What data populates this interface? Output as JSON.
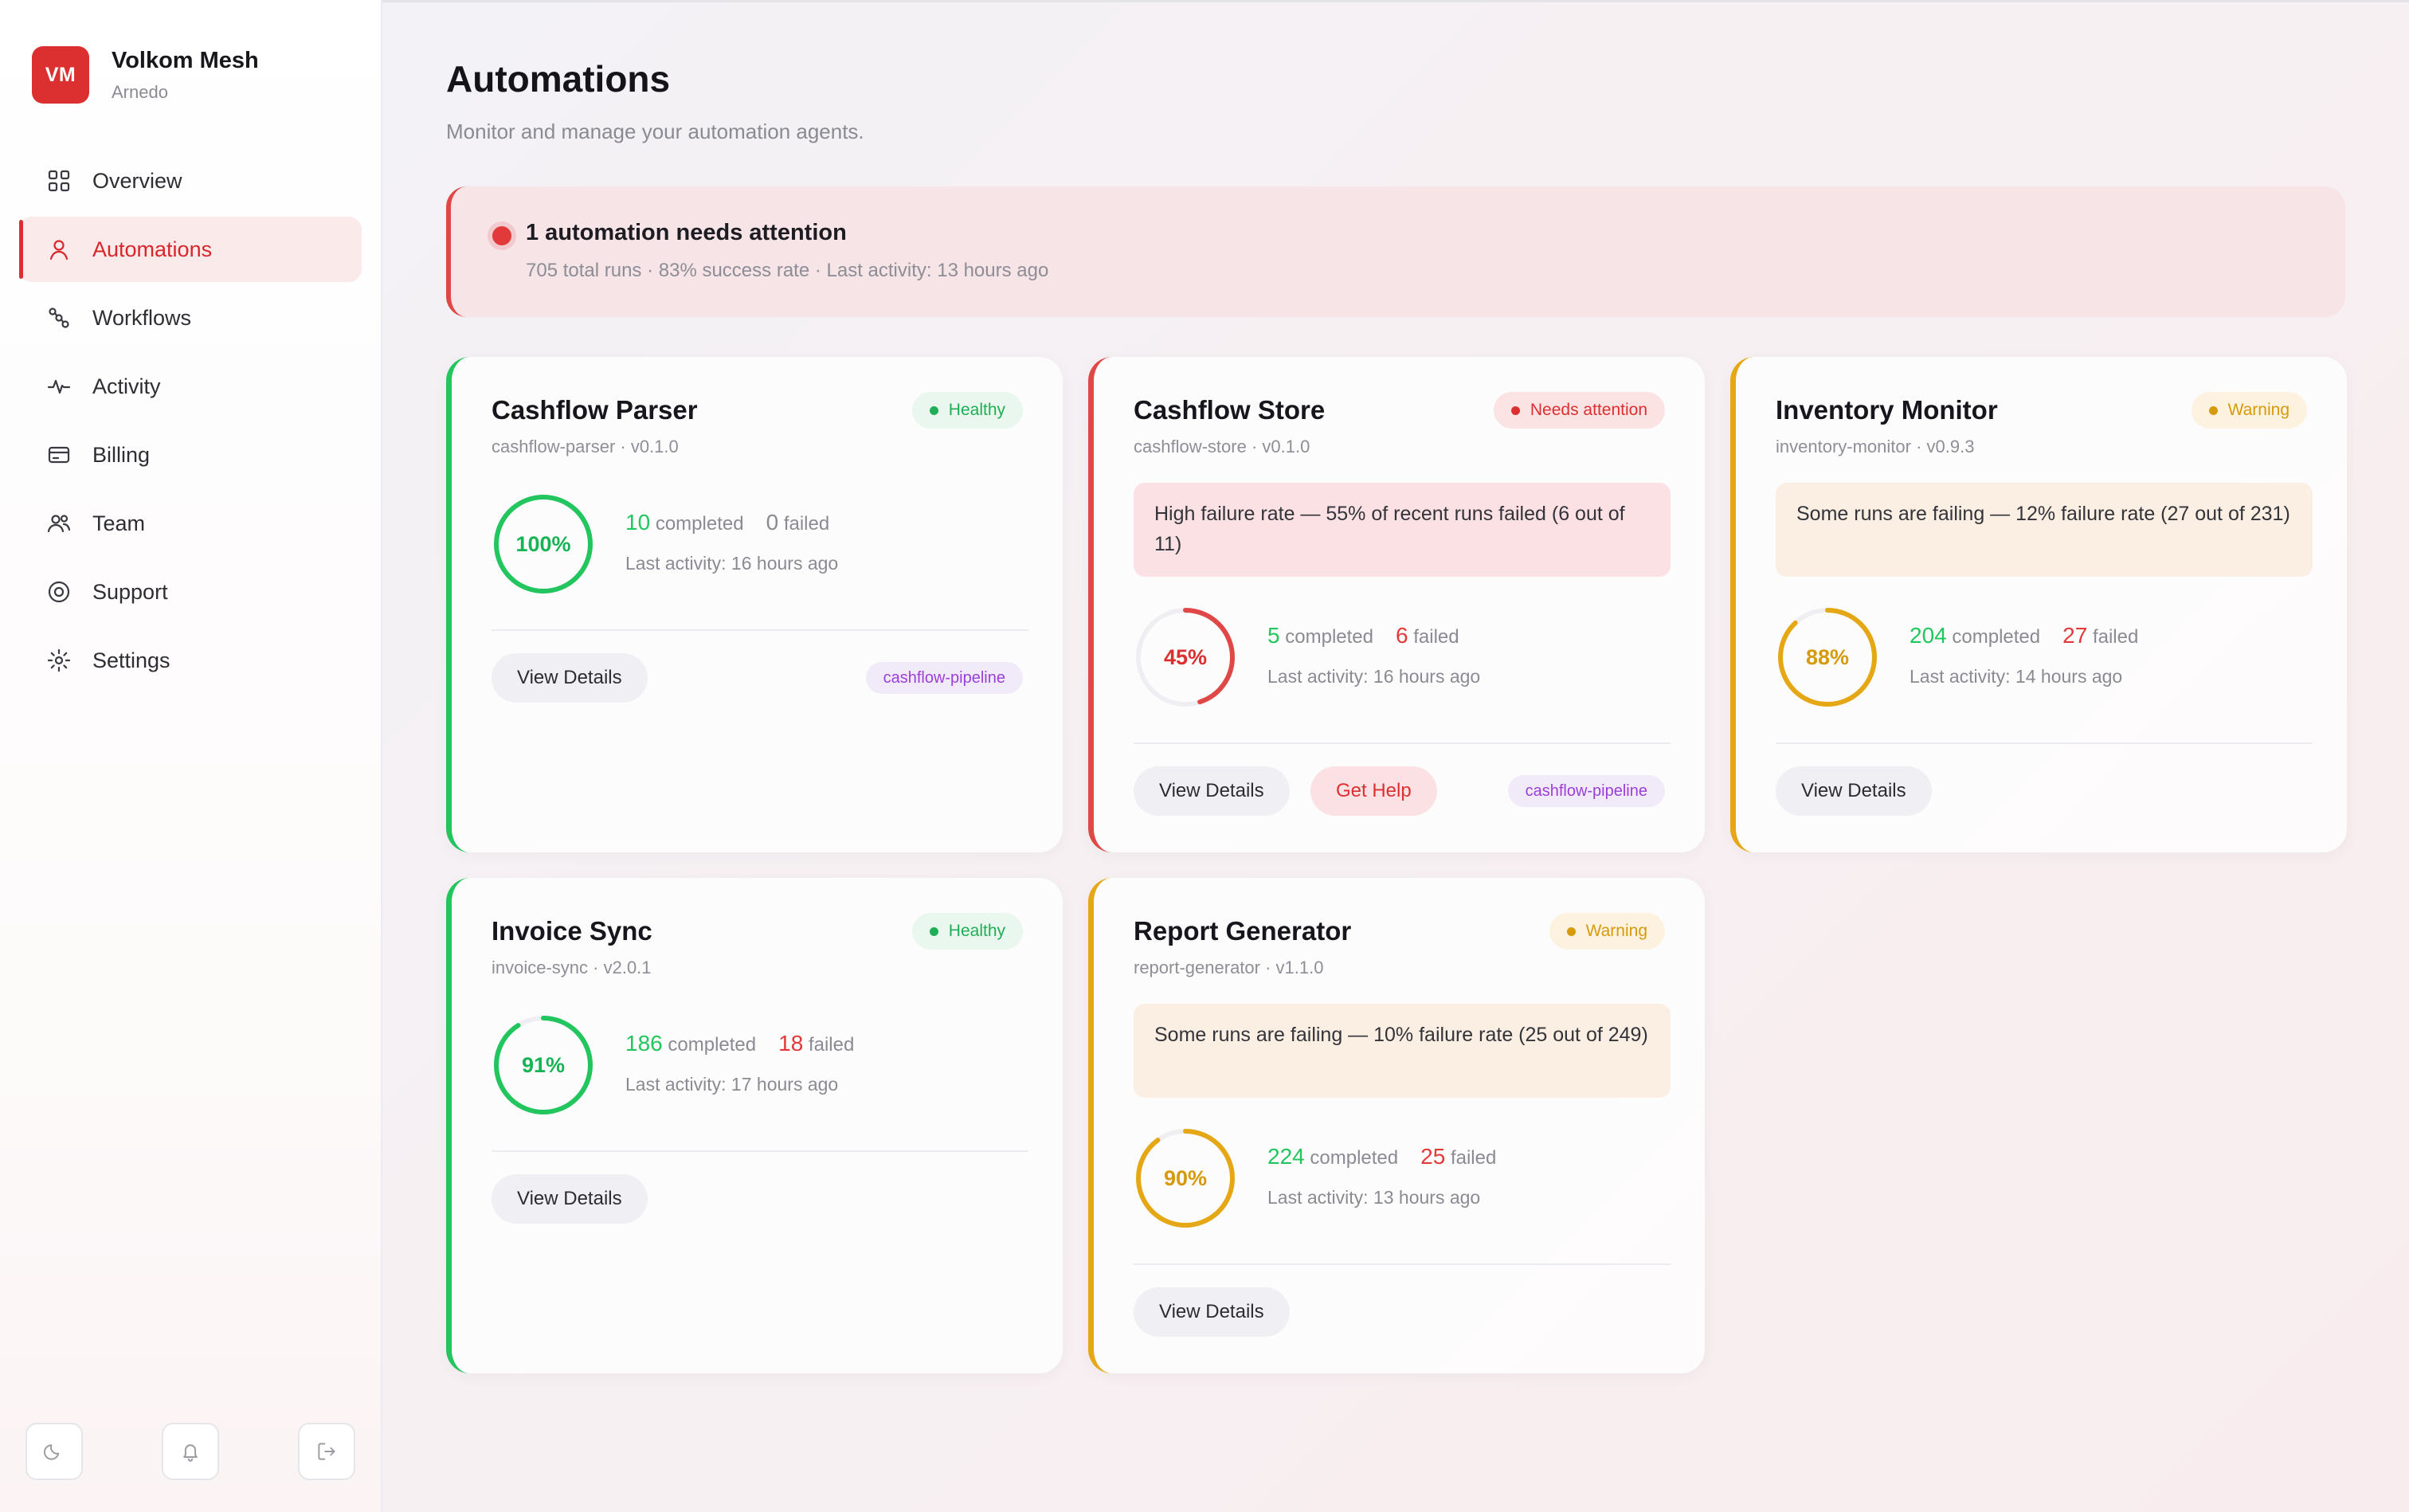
{
  "brand": {
    "initials": "VM",
    "name": "Volkom Mesh",
    "sub": "Arnedo"
  },
  "nav": [
    {
      "label": "Overview",
      "icon": "grid-icon"
    },
    {
      "label": "Automations",
      "icon": "user-icon"
    },
    {
      "label": "Workflows",
      "icon": "workflow-icon"
    },
    {
      "label": "Activity",
      "icon": "pulse-icon"
    },
    {
      "label": "Billing",
      "icon": "card-icon"
    },
    {
      "label": "Team",
      "icon": "team-icon"
    },
    {
      "label": "Support",
      "icon": "lifebuoy-icon"
    },
    {
      "label": "Settings",
      "icon": "gear-icon"
    }
  ],
  "active_nav": "Automations",
  "side_actions": [
    "moon-icon",
    "bell-icon",
    "logout-icon"
  ],
  "page": {
    "title": "Automations",
    "subtitle": "Monitor and manage your automation agents."
  },
  "alert": {
    "title": "1 automation needs attention",
    "meta": "705 total runs · 83% success rate · Last activity: 13 hours ago"
  },
  "labels": {
    "completed": "completed",
    "failed": "failed",
    "view_details": "View Details",
    "get_help": "Get Help"
  },
  "colors": {
    "accent": "#dc2f2f",
    "healthy": "#22c55e",
    "danger": "#e04848",
    "warning": "#e5a714"
  },
  "cards": [
    {
      "name": "Cashflow Parser",
      "slug": "cashflow-parser · v0.1.0",
      "status": "Healthy",
      "tone": "green",
      "percent": 100,
      "percent_label": "100%",
      "completed": "10",
      "failed": "0",
      "last": "Last activity: 16 hours ago",
      "warning": "",
      "tag": "cashflow-pipeline",
      "help": false
    },
    {
      "name": "Cashflow Store",
      "slug": "cashflow-store · v0.1.0",
      "status": "Needs attention",
      "tone": "red",
      "percent": 45,
      "percent_label": "45%",
      "completed": "5",
      "failed": "6",
      "last": "Last activity: 16 hours ago",
      "warning": "High failure rate — 55% of recent runs failed (6 out of 11)",
      "tag": "cashflow-pipeline",
      "help": true
    },
    {
      "name": "Inventory Monitor",
      "slug": "inventory-monitor · v0.9.3",
      "status": "Warning",
      "tone": "amber",
      "percent": 88,
      "percent_label": "88%",
      "completed": "204",
      "failed": "27",
      "last": "Last activity: 14 hours ago",
      "warning": "Some runs are failing — 12% failure rate (27 out of 231)",
      "tag": "",
      "help": false
    },
    {
      "name": "Invoice Sync",
      "slug": "invoice-sync · v2.0.1",
      "status": "Healthy",
      "tone": "green",
      "percent": 91,
      "percent_label": "91%",
      "completed": "186",
      "failed": "18",
      "last": "Last activity: 17 hours ago",
      "warning": "",
      "tag": "",
      "help": false
    },
    {
      "name": "Report Generator",
      "slug": "report-generator · v1.1.0",
      "status": "Warning",
      "tone": "amber",
      "percent": 90,
      "percent_label": "90%",
      "completed": "224",
      "failed": "25",
      "last": "Last activity: 13 hours ago",
      "warning": "Some runs are failing — 10% failure rate (25 out of 249)",
      "tag": "",
      "help": false
    }
  ]
}
